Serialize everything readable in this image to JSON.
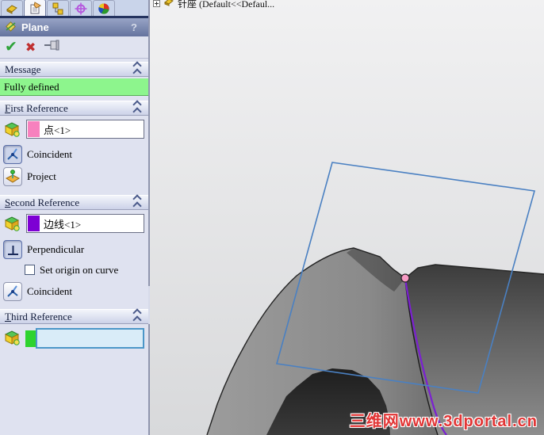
{
  "colors": {
    "accent_blue_plane": "#4a80c2",
    "selected_purple": "#7b1fd2",
    "point_pink": "#f79ac4",
    "fully_defined_green": "#8df58d",
    "panel_bg": "#dfe2f0",
    "header_top": "#98a4c6",
    "header_bottom": "#64739e",
    "active_input_bg": "#d9ecf8",
    "active_input_border": "#4b96c8",
    "first_ref_swatch": "#f781be",
    "second_ref_swatch": "#7d00d4",
    "third_ref_swatch": "#2ed32e",
    "watermark_red": "#e23535"
  },
  "panel": {
    "title": "Plane",
    "help": "?",
    "message": {
      "title": "Message",
      "status": "Fully defined"
    },
    "first_reference": {
      "title": "First Reference",
      "value": "点<1>",
      "coincident_label": "Coincident",
      "project_label": "Project"
    },
    "second_reference": {
      "title": "Second Reference",
      "value": "边线<1>",
      "perpendicular_label": "Perpendicular",
      "origin_checkbox_label": "Set origin on curve",
      "coincident_label": "Coincident"
    },
    "third_reference": {
      "title": "Third Reference",
      "value": ""
    }
  },
  "viewport": {
    "tree_item_label": "针座  (Default<<Defaul...",
    "watermark": "三维网www.3dportal.cn"
  }
}
